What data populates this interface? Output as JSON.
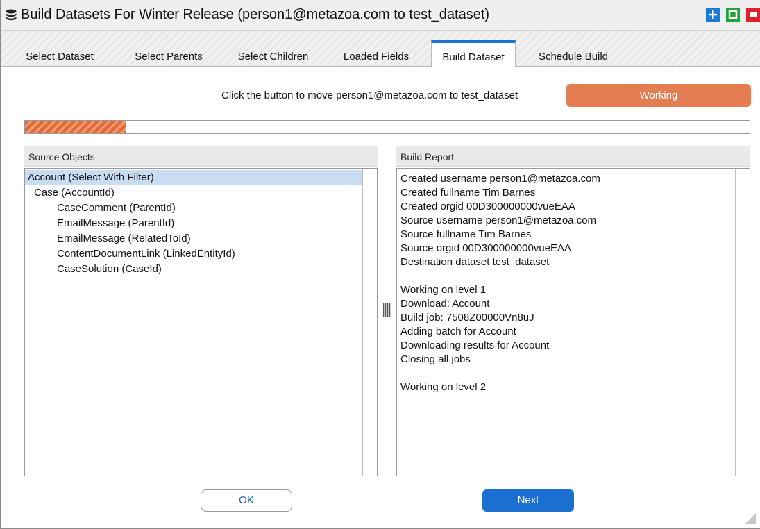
{
  "window": {
    "title": "Build Datasets For Winter Release (person1@metazoa.com to test_dataset)"
  },
  "tabs": [
    {
      "label": "Select Dataset",
      "active": false
    },
    {
      "label": "Select Parents",
      "active": false
    },
    {
      "label": "Select Children",
      "active": false
    },
    {
      "label": "Loaded Fields",
      "active": false
    },
    {
      "label": "Build Dataset",
      "active": true
    },
    {
      "label": "Schedule Build",
      "active": false
    }
  ],
  "action": {
    "prompt": "Click the button to move person1@metazoa.com to test_dataset",
    "button_label": "Working"
  },
  "progress": {
    "fraction": 0.14
  },
  "source_objects": {
    "header": "Source Objects",
    "items": [
      {
        "label": "Account (Select With Filter)",
        "level": 0,
        "selected": true
      },
      {
        "label": "Case (AccountId)",
        "level": 1,
        "selected": false
      },
      {
        "label": "CaseComment (ParentId)",
        "level": 2,
        "selected": false
      },
      {
        "label": "EmailMessage (ParentId)",
        "level": 2,
        "selected": false
      },
      {
        "label": "EmailMessage (RelatedToId)",
        "level": 2,
        "selected": false
      },
      {
        "label": "ContentDocumentLink (LinkedEntityId)",
        "level": 2,
        "selected": false
      },
      {
        "label": "CaseSolution (CaseId)",
        "level": 2,
        "selected": false
      }
    ]
  },
  "build_report": {
    "header": "Build Report",
    "lines": [
      "Created username person1@metazoa.com",
      "Created fullname Tim Barnes",
      "Created orgid 00D300000000vueEAA",
      "Source username person1@metazoa.com",
      "Source fullname Tim Barnes",
      "Source orgid 00D300000000vueEAA",
      "Destination dataset test_dataset",
      "",
      "Working on level 1",
      "Download: Account",
      "Build job: 7508Z00000Vn8uJ",
      "Adding batch for Account",
      "Downloading results for Account",
      "Closing all jobs",
      "",
      "Working on level 2"
    ]
  },
  "footer": {
    "ok_label": "OK",
    "next_label": "Next"
  },
  "colors": {
    "accent_blue": "#1a73cc",
    "working_orange": "#e47e52",
    "selection": "#c8dcf2"
  }
}
